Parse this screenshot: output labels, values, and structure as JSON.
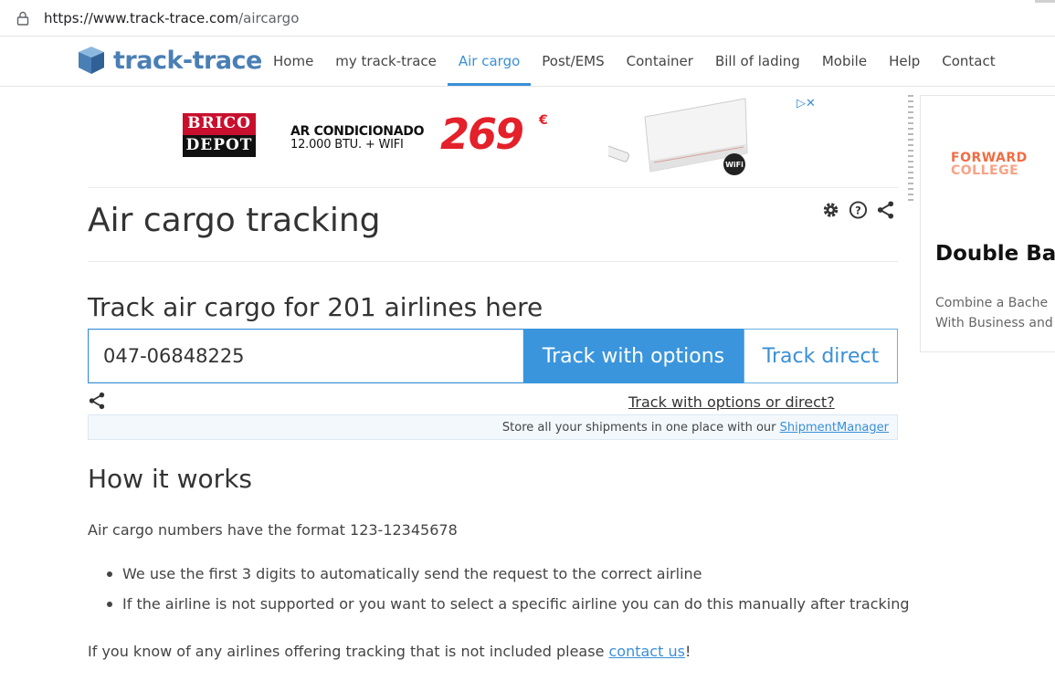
{
  "browser": {
    "url_host": "https://www.track-trace.com",
    "url_path": "/aircargo"
  },
  "header": {
    "logo_text": "track-trace",
    "nav": [
      {
        "label": "Home",
        "active": false
      },
      {
        "label": "my track-trace",
        "active": false
      },
      {
        "label": "Air cargo",
        "active": true
      },
      {
        "label": "Post/EMS",
        "active": false
      },
      {
        "label": "Container",
        "active": false
      },
      {
        "label": "Bill of lading",
        "active": false
      },
      {
        "label": "Mobile",
        "active": false
      },
      {
        "label": "Help",
        "active": false
      },
      {
        "label": "Contact",
        "active": false
      }
    ]
  },
  "ad": {
    "brand_line1": "BRICO",
    "brand_line2": "DEPOT",
    "headline": "AR CONDICIONADO",
    "subline": "12.000 BTU. + WIFI",
    "price": "269",
    "currency": "€",
    "wifi_badge": "WiFi"
  },
  "side_ad": {
    "brand_line1": "FORWARD",
    "brand_line2": "COLLEGE",
    "heading": "Double Bac",
    "desc_line1": "Combine a Bache",
    "desc_line2": "With Business and"
  },
  "main": {
    "title": "Air cargo tracking",
    "subtitle": "Track air cargo for 201 airlines here",
    "tracking_number": "047-06848225",
    "btn_options": "Track with options",
    "btn_direct": "Track direct",
    "options_link": "Track with options or direct?",
    "store_text": "Store all your shipments in one place with our ",
    "store_link": "ShipmentManager"
  },
  "how": {
    "heading": "How it works",
    "format_text": "Air cargo numbers have the format 123-12345678",
    "bullets": [
      "We use the first 3 digits to automatically send the request to the correct airline",
      "If the airline is not supported or you want to select a specific airline you can do this manually after tracking"
    ],
    "footer_text": "If you know of any airlines offering tracking that is not included please ",
    "footer_link": "contact us",
    "footer_end": "!"
  },
  "colors": {
    "accent": "#3a8fd8",
    "logo": "#4a7fb5",
    "price": "#e4202a",
    "forward": "#f06c43"
  }
}
